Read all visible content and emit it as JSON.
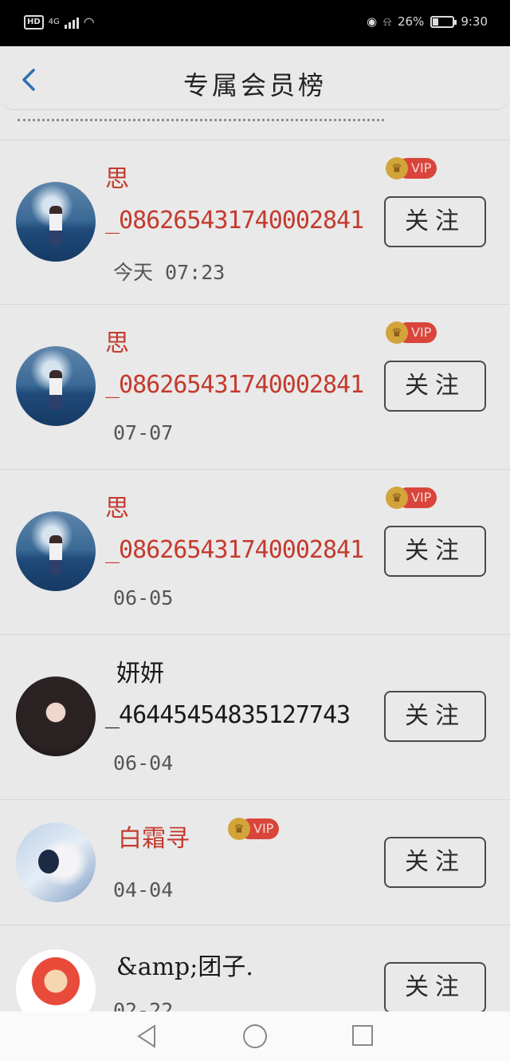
{
  "status_bar": {
    "hd": "HD",
    "network": "4G",
    "battery": "26%",
    "battery_level": 0.26,
    "time": "9:30"
  },
  "header": {
    "title": "专属会员榜",
    "back_icon": "chevron-left-icon"
  },
  "list": {
    "follow_label": "关注",
    "vip_label": "VIP",
    "items": [
      {
        "name": "思",
        "id": "_086265431740002841",
        "time": "今天 07:23",
        "vip": true
      },
      {
        "name": "思",
        "id": "_086265431740002841",
        "time": "07-07",
        "vip": true
      },
      {
        "name": "思",
        "id": "_086265431740002841",
        "time": "06-05",
        "vip": true
      },
      {
        "name": "妍妍",
        "id": "_46445454835127743",
        "time": "06-04",
        "vip": false
      },
      {
        "name": "白霜寻",
        "id": "",
        "time": "04-04",
        "vip": true
      },
      {
        "name": "&amp;团子.",
        "id": "",
        "time": "02-22",
        "vip": false
      }
    ]
  },
  "nav_bar": {
    "back": "triangle-back-icon",
    "home": "circle-home-icon",
    "recent": "square-recent-icon"
  },
  "colors": {
    "vip_name": "#c43a2e",
    "back_arrow": "#2e6fb0",
    "vip_badge": "#d9453b",
    "crown": "#d3a43a"
  }
}
